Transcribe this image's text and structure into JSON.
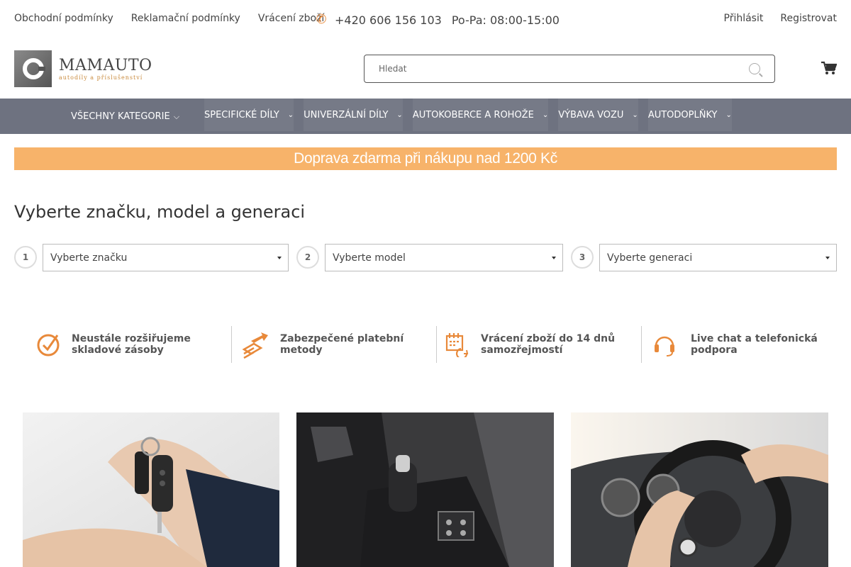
{
  "topbar": {
    "links": [
      "Obchodní podmínky",
      "Reklamační podmínky",
      "Vrácení zboží"
    ],
    "phone": "+420 606 156 103",
    "hours": "Po-Pa: 08:00-15:00",
    "login": "Přihlásit",
    "register": "Registrovat"
  },
  "header": {
    "logo_name": "MAMAUTO",
    "logo_tagline": "autodíly a příslušenství",
    "search_placeholder": "Hledat"
  },
  "nav": {
    "all_categories": "VŠECHNY KATEGORIE",
    "items": [
      "SPECIFICKÉ DÍLY",
      "UNIVERZÁLNÍ DÍLY",
      "AUTOKOBERCE A ROHOŽE",
      "VÝBAVA VOZU",
      "AUTODOPLŇKY"
    ]
  },
  "banner": "Doprava zdarma při nákupu nad 1200 Kč",
  "selector": {
    "title": "Vyberte značku, model a generaci",
    "steps": [
      {
        "num": "1",
        "placeholder": "Vyberte značku"
      },
      {
        "num": "2",
        "placeholder": "Vyberte model"
      },
      {
        "num": "3",
        "placeholder": "Vyberte generaci"
      }
    ]
  },
  "features": [
    {
      "icon": "check-circle-icon",
      "text": "Neustále rozšiřujeme skladové zásoby"
    },
    {
      "icon": "payment-icon",
      "text": "Zabezpečené platební metody"
    },
    {
      "icon": "calendar-return-icon",
      "text": "Vrácení zboží do 14 dnů samozřejmostí"
    },
    {
      "icon": "headset-icon",
      "text": "Live chat a telefonická podpora"
    }
  ],
  "colors": {
    "accent": "#e8893a",
    "nav_bg": "#6e7280",
    "banner_bg": "#f7b36a"
  }
}
